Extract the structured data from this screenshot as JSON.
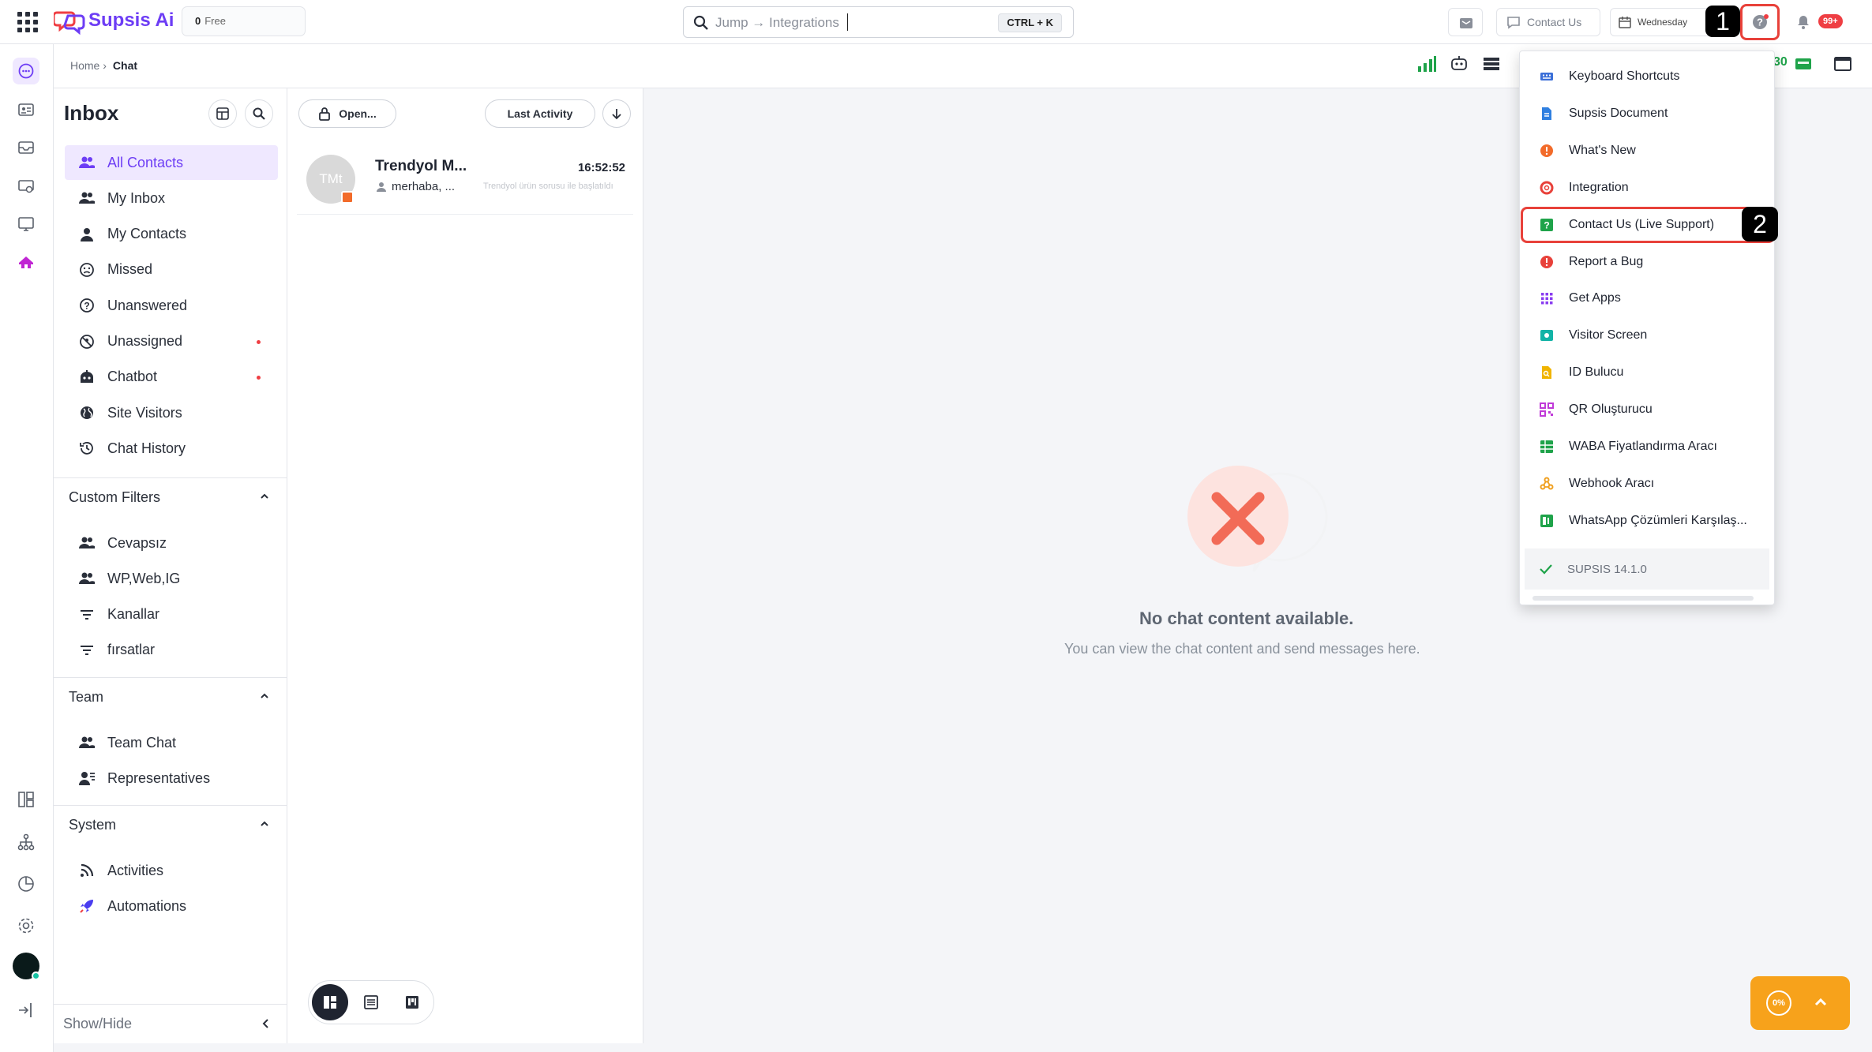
{
  "app": {
    "name": "Supsis Ai",
    "plan_count": "0",
    "plan_name": "Free"
  },
  "search": {
    "placeholder": "Jump → Integrations",
    "shortcut": "CTRL + K"
  },
  "topbar": {
    "contact_us": "Contact Us",
    "date_label": "Wednesday",
    "notification_count": "99+",
    "annotation_1": "1"
  },
  "breadcrumb": {
    "home": "Home ›",
    "current": "Chat"
  },
  "inbox": {
    "title": "Inbox",
    "items": [
      {
        "label": "All Contacts",
        "icon": "people-icon",
        "active": true
      },
      {
        "label": "My Inbox",
        "icon": "people-icon"
      },
      {
        "label": "My Contacts",
        "icon": "person-icon"
      },
      {
        "label": "Missed",
        "icon": "sad-face-icon"
      },
      {
        "label": "Unanswered",
        "icon": "question-circle-icon"
      },
      {
        "label": "Unassigned",
        "icon": "blocked-icon",
        "dot": true
      },
      {
        "label": "Chatbot",
        "icon": "robot-icon",
        "dot": true
      },
      {
        "label": "Site Visitors",
        "icon": "globe-icon"
      },
      {
        "label": "Chat History",
        "icon": "history-icon"
      }
    ]
  },
  "custom_filters": {
    "title": "Custom Filters",
    "items": [
      {
        "label": "Cevapsız",
        "icon": "people-icon"
      },
      {
        "label": "WP,Web,IG",
        "icon": "people-icon"
      },
      {
        "label": "Kanallar",
        "icon": "filter-icon"
      },
      {
        "label": "fırsatlar",
        "icon": "filter-icon"
      }
    ]
  },
  "team": {
    "title": "Team",
    "items": [
      {
        "label": "Team Chat",
        "icon": "people-icon"
      },
      {
        "label": "Representatives",
        "icon": "agent-icon"
      }
    ]
  },
  "system": {
    "title": "System",
    "items": [
      {
        "label": "Activities",
        "icon": "rss-icon"
      },
      {
        "label": "Automations",
        "icon": "rocket-icon"
      }
    ]
  },
  "sidebar_footer": {
    "label": "Show/Hide"
  },
  "list": {
    "status_filter": "Open...",
    "sort": "Last Activity",
    "conversations": [
      {
        "avatar": "TMt",
        "name": "Trendyol M...",
        "time": "16:52:52",
        "preview": "merhaba, ...",
        "sub": "Trendyol ürün sorusu ile başlatıldı"
      }
    ]
  },
  "empty_state": {
    "title": "No chat content available.",
    "subtitle": "You can view the chat content and send messages here."
  },
  "toolbar": {
    "partial_count": "30"
  },
  "help_menu": {
    "items": [
      {
        "label": "Keyboard Shortcuts",
        "icon": "keyboard-icon",
        "color": "#3b6fd8"
      },
      {
        "label": "Supsis Document",
        "icon": "document-icon",
        "color": "#2f7fe0"
      },
      {
        "label": "What's New",
        "icon": "badge-alert-icon",
        "color": "#f26b2a"
      },
      {
        "label": "Integration",
        "icon": "lifebuoy-icon",
        "color": "#e8413a"
      },
      {
        "label": "Contact Us (Live Support)",
        "icon": "help-square-icon",
        "color": "#1fa34a"
      },
      {
        "label": "Report a Bug",
        "icon": "alert-circle-icon",
        "color": "#e8413a"
      },
      {
        "label": "Get Apps",
        "icon": "apps-grid-icon",
        "color": "#8a3df0"
      },
      {
        "label": "Visitor Screen",
        "icon": "screen-icon",
        "color": "#12b3a6"
      },
      {
        "label": "ID Bulucu",
        "icon": "file-search-icon",
        "color": "#f0b400"
      },
      {
        "label": "QR Oluşturucu",
        "icon": "qr-icon",
        "color": "#c03ad8"
      },
      {
        "label": "WABA Fiyatlandırma Aracı",
        "icon": "sheet-icon",
        "color": "#1fa34a"
      },
      {
        "label": "Webhook Aracı",
        "icon": "webhook-icon",
        "color": "#f0a020"
      },
      {
        "label": "WhatsApp Çözümleri Karşılaş...",
        "icon": "compare-icon",
        "color": "#1fa34a"
      }
    ],
    "version": "SUPSIS 14.1.0",
    "annotation_2": "2"
  },
  "widget": {
    "progress": "0%"
  },
  "colors": {
    "brand": "#6d3df5",
    "annotation": "#e8413a",
    "widget": "#f7a21b"
  }
}
